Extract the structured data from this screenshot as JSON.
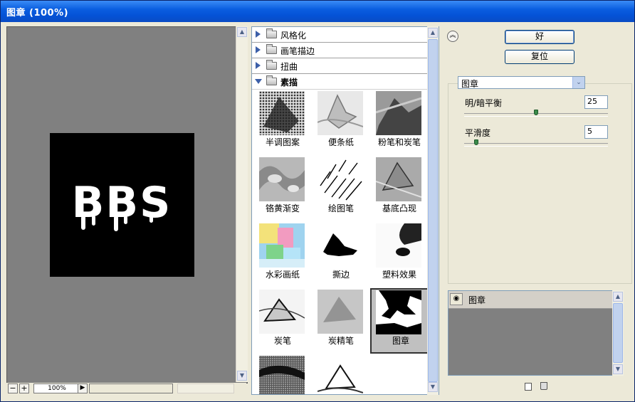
{
  "window": {
    "title": "图章 (100%)"
  },
  "preview": {
    "stamp_text": "BBS",
    "zoom": "100%",
    "zoom_out": "−",
    "zoom_in": "+",
    "menu_arrow": "▶"
  },
  "gallery": {
    "categories": [
      {
        "label": "风格化",
        "expanded": false
      },
      {
        "label": "画笔描边",
        "expanded": false
      },
      {
        "label": "扭曲",
        "expanded": false
      },
      {
        "label": "素描",
        "expanded": true
      }
    ],
    "filters": [
      "半调图案",
      "便条纸",
      "粉笔和炭笔",
      "铬黄渐变",
      "绘图笔",
      "基底凸现",
      "水彩画纸",
      "撕边",
      "塑料效果",
      "炭笔",
      "炭精笔",
      "图章"
    ],
    "selected": "图章"
  },
  "actions": {
    "ok": "好",
    "reset": "复位",
    "collapse": "︽"
  },
  "filter_select": {
    "value": "图章",
    "arrow": "⌄"
  },
  "params": [
    {
      "label": "明/暗平衡",
      "value": "25",
      "min": 1,
      "max": 50
    },
    {
      "label": "平滑度",
      "value": "5",
      "min": 1,
      "max": 50
    }
  ],
  "layers": [
    {
      "name": "图章",
      "visible": true
    }
  ],
  "colors": {
    "titlebar": "#0452d6",
    "panel": "#ece9d8",
    "preview_bg": "#808080",
    "slider_knob": "#3b8a4a"
  }
}
